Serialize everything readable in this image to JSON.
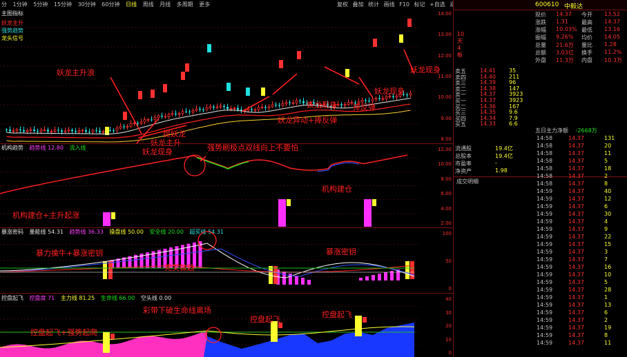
{
  "toolbar": {
    "items": [
      "分",
      "1分钟",
      "5分钟",
      "15分钟",
      "30分钟",
      "60分钟",
      "日线",
      "周线",
      "月线",
      "多周期",
      "更多"
    ],
    "right_items": [
      "复权",
      "叠加",
      "统计",
      "画线",
      "F10",
      "标记",
      "+自选",
      "返回"
    ]
  },
  "panel1": {
    "title": "主图指标",
    "legend": [
      {
        "text": "妖龙主升",
        "color": "#ff3030"
      },
      {
        "text": "强势趋势",
        "color": "#30e0e0"
      },
      {
        "text": "龙头信号",
        "color": "#ffff30"
      }
    ],
    "ylabels": [
      "14.00",
      "13.00",
      "12.00",
      "11.00",
      "10.00",
      "9.00",
      "8.00"
    ],
    "annotations": [
      "妖龙主升浪",
      "妖龙现身",
      "妖龙异动+捧反弹",
      "捧反弹",
      "妖龙现身",
      "妖龙现身",
      "提妖龙",
      "妖龙主升",
      "妖龙现身"
    ],
    "tag": "10天 4板",
    "price_tag": "14.37"
  },
  "panel2": {
    "title": "机构趋势",
    "fields": [
      "趋势线 12.80",
      "流入线"
    ],
    "ylabels": [
      "12.00",
      "10.00",
      "8.00",
      "6.00",
      "4.00",
      "2.00"
    ],
    "annotations": [
      "强势刷极点双线向上不要怕",
      "机构建仓",
      "机构建仓+主升起涨"
    ],
    "bar_label": "机构建仓"
  },
  "panel3": {
    "title": "暴涨密码",
    "fields": [
      "量能线 54.31",
      "趋势线 36.33",
      "操盘线 50.00",
      "安全线 20.00",
      "超买线 54.31"
    ],
    "ylabels": [
      "100",
      "50",
      "0"
    ],
    "annotations": [
      "暴力擒牛+暴涨密钥",
      "死叉做趋",
      "暴涨密钥"
    ],
    "bar_label": "暴涨密钥"
  },
  "panel4": {
    "title": "控盘起飞",
    "fields": [
      "控盘度 71",
      "主力线 81.25",
      "生命线 66.00",
      "空头线 0.00"
    ],
    "ylabels": [
      "40",
      "30",
      "20",
      "10",
      "0"
    ],
    "annotations": [
      "彩带下破生命线离场",
      "控盘起飞",
      "控盘起飞",
      "控盘起飞+强势起爬"
    ],
    "bar_label": "控盘起飞"
  },
  "quote": {
    "code": "600610",
    "name": "中毅达",
    "rows": [
      {
        "l1": "现价",
        "v1": "14.37",
        "l2": "今开",
        "v2": "13.52"
      },
      {
        "l1": "涨跌",
        "v1": "1.31",
        "l2": "最高",
        "v2": "14.37"
      },
      {
        "l1": "涨幅",
        "v1": "10.03%",
        "l2": "最低",
        "v2": "13.16"
      },
      {
        "l1": "振幅",
        "v1": "9.26%",
        "l2": "均价",
        "v2": "14.05"
      },
      {
        "l1": "总量",
        "v1": "21.6万",
        "l2": "量比",
        "v2": "1.28"
      },
      {
        "l1": "总额",
        "v1": "3.03亿",
        "l2": "换手",
        "v2": "11.2%"
      },
      {
        "l1": "外盘",
        "v1": "11.3万",
        "l2": "内盘",
        "v2": "10.3万"
      }
    ],
    "sell": [
      {
        "l": "卖五",
        "p": "14.41",
        "v": "35"
      },
      {
        "l": "卖四",
        "p": "14.40",
        "v": "211"
      },
      {
        "l": "卖三",
        "p": "14.39",
        "v": "96"
      },
      {
        "l": "卖二",
        "p": "14.38",
        "v": "147"
      },
      {
        "l": "卖一",
        "p": "14.37",
        "v": "3923"
      }
    ],
    "buy": [
      {
        "l": "买一",
        "p": "14.37",
        "v": "3923"
      },
      {
        "l": "买二",
        "p": "14.36",
        "v": "167"
      },
      {
        "l": "买三",
        "p": "14.35",
        "v": "9.6"
      },
      {
        "l": "买四",
        "p": "14.34",
        "v": "7.9"
      },
      {
        "l": "买五",
        "p": "14.33",
        "v": "6.6"
      }
    ],
    "stats": [
      {
        "l": "流通股",
        "v": "19.4亿"
      },
      {
        "l": "总股本",
        "v": "19.4亿"
      },
      {
        "l": "市盈率",
        "v": "-"
      },
      {
        "l": "净资产",
        "v": "1.98"
      }
    ],
    "flow_title": "五日主力净额",
    "flow_value": "-2668万",
    "detail_title": "成交明细",
    "ticks": [
      {
        "t": "14:58",
        "p": "14.37",
        "v": "131"
      },
      {
        "t": "14:58",
        "p": "14.37",
        "v": "20"
      },
      {
        "t": "14:58",
        "p": "14.37",
        "v": "11"
      },
      {
        "t": "14:58",
        "p": "14.37",
        "v": "5"
      },
      {
        "t": "14:58",
        "p": "14.37",
        "v": "18"
      },
      {
        "t": "14:58",
        "p": "14.37",
        "v": "2"
      },
      {
        "t": "14:58",
        "p": "14.37",
        "v": "8"
      },
      {
        "t": "14:59",
        "p": "14.37",
        "v": "40"
      },
      {
        "t": "14:59",
        "p": "14.37",
        "v": "12"
      },
      {
        "t": "14:59",
        "p": "14.37",
        "v": "6"
      },
      {
        "t": "14:59",
        "p": "14.37",
        "v": "30"
      },
      {
        "t": "14:59",
        "p": "14.37",
        "v": "4"
      },
      {
        "t": "14:59",
        "p": "14.37",
        "v": "9"
      },
      {
        "t": "14:59",
        "p": "14.37",
        "v": "22"
      },
      {
        "t": "14:59",
        "p": "14.37",
        "v": "15"
      },
      {
        "t": "14:59",
        "p": "14.37",
        "v": "3"
      },
      {
        "t": "14:59",
        "p": "14.37",
        "v": "7"
      },
      {
        "t": "14:59",
        "p": "14.37",
        "v": "16"
      },
      {
        "t": "14:59",
        "p": "14.37",
        "v": "10"
      },
      {
        "t": "14:59",
        "p": "14.37",
        "v": "5"
      },
      {
        "t": "14:59",
        "p": "14.37",
        "v": "28"
      },
      {
        "t": "14:59",
        "p": "14.37",
        "v": "1"
      },
      {
        "t": "14:59",
        "p": "14.37",
        "v": "13"
      },
      {
        "t": "14:59",
        "p": "14.37",
        "v": "6"
      },
      {
        "t": "14:59",
        "p": "14.37",
        "v": "2"
      },
      {
        "t": "14:59",
        "p": "14.37",
        "v": "19"
      },
      {
        "t": "14:59",
        "p": "14.37",
        "v": "8"
      },
      {
        "t": "14:59",
        "p": "14.37",
        "v": "11"
      }
    ],
    "colors": {
      "up": "#ff3030",
      "down": "#20e020",
      "text": "#c0c0c0",
      "yellow": "#ffff30",
      "border": "#7a1010"
    }
  }
}
